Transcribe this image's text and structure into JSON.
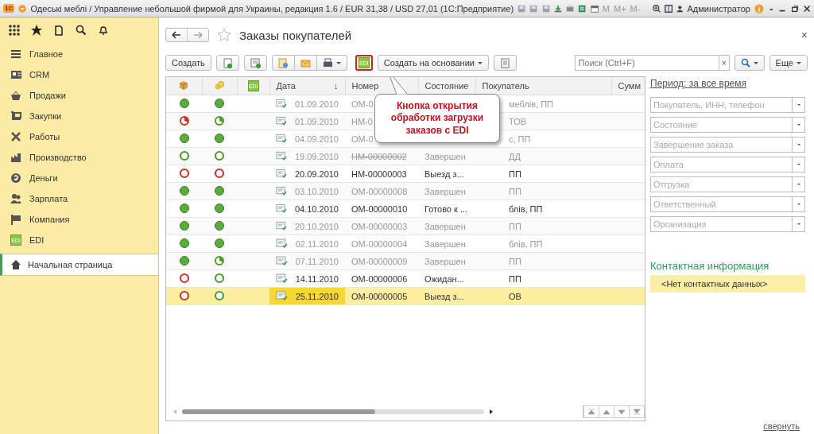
{
  "window": {
    "logo": "1С",
    "title": "Одеські меблі / Управление небольшой фирмой для Украины, редакция 1.6 / EUR 31,38 / USD 27,01  (1С:Предприятие)",
    "memory_buttons": [
      "M",
      "M+",
      "M-"
    ],
    "user": "Администратор"
  },
  "sidebar": {
    "items": [
      {
        "label": "Главное",
        "selected": false
      },
      {
        "label": "CRM",
        "selected": false
      },
      {
        "label": "Продажи",
        "selected": false
      },
      {
        "label": "Закупки",
        "selected": false
      },
      {
        "label": "Работы",
        "selected": false
      },
      {
        "label": "Производство",
        "selected": false
      },
      {
        "label": "Деньги",
        "selected": false
      },
      {
        "label": "Зарплата",
        "selected": false
      },
      {
        "label": "Компания",
        "selected": false
      },
      {
        "label": "EDI",
        "icon_text": "EDI",
        "selected": false
      }
    ],
    "home": {
      "label": "Начальная страница",
      "selected": true
    }
  },
  "form": {
    "title": "Заказы покупателей",
    "close": "×"
  },
  "toolbar": {
    "create": "Создать",
    "edi_button": {
      "label": "EDI",
      "highlighted": true
    },
    "create_based_on": "Создать на основании",
    "search": {
      "placeholder": "Поиск (Ctrl+F)",
      "clear": "×"
    },
    "more": "Еще"
  },
  "table": {
    "columns": [
      {
        "kind": "icon"
      },
      {
        "kind": "icon"
      },
      {
        "kind": "edi",
        "label": "EDI"
      },
      {
        "kind": "text",
        "label": "Дата",
        "sort": "↓"
      },
      {
        "kind": "text",
        "label": "Номер"
      },
      {
        "kind": "text",
        "label": "Состояние"
      },
      {
        "kind": "text",
        "label": "Покупатель"
      },
      {
        "kind": "text",
        "label": "Сумм"
      }
    ],
    "rows": [
      {
        "shipment": {
          "kind": "full",
          "color": "#5aac3c"
        },
        "payment": {
          "kind": "full",
          "color": "#5aac3c"
        },
        "date": "01.09.2010",
        "number": "ОМ-0",
        "customer": "меблів, ПП",
        "closed": true,
        "deleted": false,
        "selected": false
      },
      {
        "shipment": {
          "kind": "partial",
          "color": "#c0392b"
        },
        "payment": {
          "kind": "partial",
          "color": "#4e9a2e"
        },
        "date": "01.09.2010",
        "number": "НМ-0",
        "customer": "ТОВ",
        "closed": true,
        "deleted": false,
        "selected": false
      },
      {
        "shipment": {
          "kind": "full",
          "color": "#5aac3c"
        },
        "payment": {
          "kind": "full",
          "color": "#5aac3c"
        },
        "date": "04.09.2010",
        "number": "ОМ-0",
        "customer": "с, ПП",
        "closed": true,
        "deleted": false,
        "selected": false
      },
      {
        "shipment": {
          "kind": "none",
          "color": "#4e9a2e"
        },
        "payment": {
          "kind": "none",
          "color": "#4e9a2e"
        },
        "date": "19.09.2010",
        "number": "НМ-00000002",
        "state": "Завершен",
        "customer": "ДД",
        "closed": true,
        "deleted": true,
        "selected": false
      },
      {
        "shipment": {
          "kind": "none",
          "color": "#c0392b"
        },
        "payment": {
          "kind": "none",
          "color": "#c0392b"
        },
        "date": "20.09.2010",
        "number": "НМ-00000003",
        "state": "Выезд з...",
        "customer": "ПП",
        "closed": false,
        "deleted": false,
        "selected": false
      },
      {
        "shipment": {
          "kind": "full",
          "color": "#5aac3c"
        },
        "payment": {
          "kind": "full",
          "color": "#5aac3c"
        },
        "date": "03.10.2010",
        "number": "ОМ-00000008",
        "state": "Завершен",
        "customer": "ПП",
        "closed": true,
        "deleted": false,
        "selected": false
      },
      {
        "shipment": {
          "kind": "full",
          "color": "#5aac3c"
        },
        "payment": {
          "kind": "full",
          "color": "#5aac3c"
        },
        "date": "04.10.2010",
        "number": "ОМ-00000010",
        "state": "Готово к ...",
        "customer": "блів, ПП",
        "closed": false,
        "deleted": false,
        "selected": false
      },
      {
        "shipment": {
          "kind": "full",
          "color": "#5aac3c"
        },
        "payment": {
          "kind": "full",
          "color": "#5aac3c"
        },
        "date": "20.10.2010",
        "number": "ОМ-00000003",
        "state": "Завершен",
        "customer": "ПП",
        "closed": true,
        "deleted": false,
        "selected": false
      },
      {
        "shipment": {
          "kind": "full",
          "color": "#5aac3c"
        },
        "payment": {
          "kind": "full",
          "color": "#5aac3c"
        },
        "date": "02.11.2010",
        "number": "ОМ-00000004",
        "state": "Завершен",
        "customer": "блів, ПП",
        "closed": true,
        "deleted": false,
        "selected": false
      },
      {
        "shipment": {
          "kind": "full",
          "color": "#5aac3c"
        },
        "payment": {
          "kind": "partial",
          "color": "#4e9a2e"
        },
        "date": "07.11.2010",
        "number": "ОМ-00000009",
        "state": "Завершен",
        "customer": "ПП",
        "closed": true,
        "deleted": false,
        "selected": false
      },
      {
        "shipment": {
          "kind": "none",
          "color": "#c0392b"
        },
        "payment": {
          "kind": "none",
          "color": "#4e9a2e"
        },
        "date": "14.11.2010",
        "number": "ОМ-00000006",
        "state": "Ожидан...",
        "customer": "ПП",
        "closed": false,
        "deleted": false,
        "selected": false
      },
      {
        "shipment": {
          "kind": "none",
          "color": "#c0392b"
        },
        "payment": {
          "kind": "none",
          "color": "#4e9a2e"
        },
        "date": "25.11.2010",
        "number": "ОМ-00000005",
        "state": "Выезд з...",
        "customer": "ОВ",
        "closed": false,
        "deleted": false,
        "selected": true
      }
    ]
  },
  "callout": {
    "text": "Кнопка открытия обработки загрузки заказов с EDI"
  },
  "filters": {
    "period": "Период: за все время",
    "fields": [
      {
        "placeholder": "Покупатель, ИНН, телефон"
      },
      {
        "placeholder": "Состояние"
      },
      {
        "placeholder": "Завершение заказа"
      },
      {
        "placeholder": "Оплата"
      },
      {
        "placeholder": "Отгрузка"
      },
      {
        "placeholder": "Ответственный"
      },
      {
        "placeholder": "Организация"
      }
    ]
  },
  "contact": {
    "title": "Контактная информация",
    "text": "<Нет контактных данных>"
  },
  "collapse_link": "свернуть"
}
